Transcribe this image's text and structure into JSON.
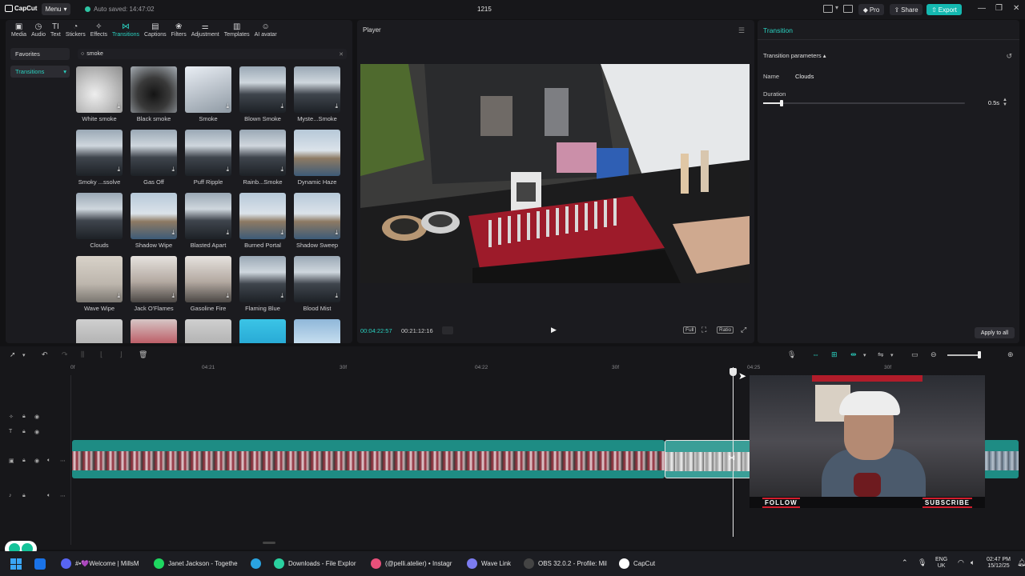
{
  "titlebar": {
    "app_name": "CapCut",
    "menu_label": "Menu",
    "autosave_text": "Auto saved: 14:47:02",
    "project_name": "1215",
    "pro_label": "Pro",
    "share_label": "Share",
    "export_label": "Export"
  },
  "toolbar": {
    "items": [
      {
        "label": "Media",
        "icon": "media-icon"
      },
      {
        "label": "Audio",
        "icon": "audio-icon"
      },
      {
        "label": "Text",
        "icon": "text-icon"
      },
      {
        "label": "Stickers",
        "icon": "stickers-icon"
      },
      {
        "label": "Effects",
        "icon": "effects-icon"
      },
      {
        "label": "Transitions",
        "icon": "transitions-icon"
      },
      {
        "label": "Captions",
        "icon": "captions-icon"
      },
      {
        "label": "Filters",
        "icon": "filters-icon"
      },
      {
        "label": "Adjustment",
        "icon": "adjustment-icon"
      },
      {
        "label": "Templates",
        "icon": "templates-icon"
      },
      {
        "label": "AI avatar",
        "icon": "ai-avatar-icon"
      }
    ],
    "active_index": 5
  },
  "sidebar": {
    "items": [
      {
        "label": "Favorites"
      },
      {
        "label": "Transitions"
      }
    ]
  },
  "search": {
    "value": "smoke"
  },
  "transitions": [
    "White smoke",
    "Black smoke",
    "Smoke",
    "Blown Smoke",
    "Myste...Smoke",
    "Smoky ...ssolve",
    "Gas Off",
    "Puff Ripple",
    "Rainb...Smoke",
    "Dynamic Haze",
    "Clouds",
    "Shadow Wipe",
    "Blasted Apart",
    "Burned Portal",
    "Shadow Sweep",
    "Wave Wipe",
    "Jack O'Flames",
    "Gasoline Fire",
    "Flaming Blue",
    "Blood Mist"
  ],
  "player": {
    "title": "Player",
    "current_time": "00:04:22:57",
    "total_time": "00:21:12:16",
    "full_label": "Full",
    "ratio_label": "Ratio"
  },
  "transition_panel": {
    "title": "Transition",
    "section": "Transition parameters",
    "name_label": "Name",
    "name_value": "Clouds",
    "duration_label": "Duration",
    "duration_value": "0.5s",
    "duration_fraction": 0.09,
    "apply_label": "Apply to all"
  },
  "timeline": {
    "ruler": [
      "0f",
      "04:21",
      "30f",
      "04:22",
      "30f",
      "04:25",
      "30f"
    ]
  },
  "overlay": {
    "follow": "FOLLOW",
    "subscribe": "SUBSCRIBE"
  },
  "taskbar": {
    "items": [
      {
        "label": "#•💜Welcome | MillsM",
        "color": "#5865f2"
      },
      {
        "label": "Janet Jackson - Togethe",
        "color": "#1ed760"
      },
      {
        "label": "",
        "color": "#2aa3e0"
      },
      {
        "label": "Downloads - File Explor",
        "color": "#2ad1a0"
      },
      {
        "label": "(@pelli.atelier) • Instagr",
        "color": "#e8507a"
      },
      {
        "label": "Wave Link",
        "color": "#7c7cf0"
      },
      {
        "label": "OBS 32.0.2 - Profile: Mil",
        "color": "#444"
      },
      {
        "label": "CapCut",
        "color": "#ffffff"
      }
    ],
    "lang": "ENG",
    "region": "UK",
    "time": "02:47 PM",
    "date": "15/12/25"
  }
}
